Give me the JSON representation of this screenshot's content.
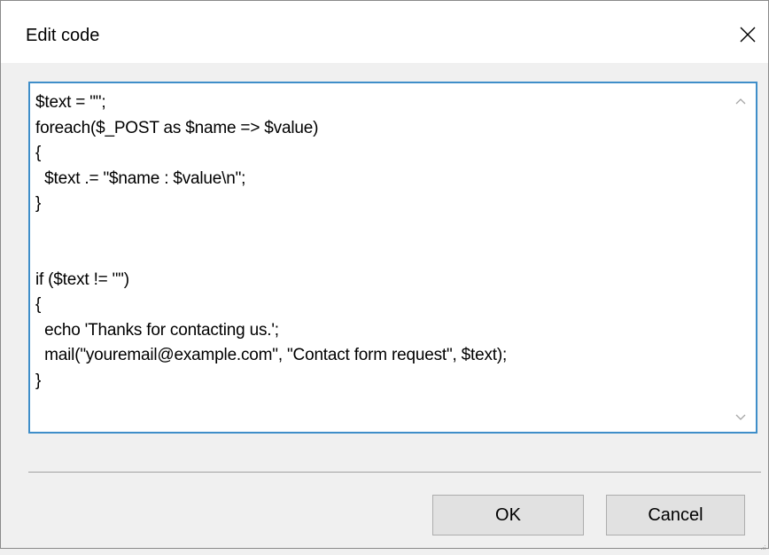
{
  "dialog": {
    "title": "Edit code",
    "close_icon": "close-icon"
  },
  "editor": {
    "code": "$text = \"\";\nforeach($_POST as $name => $value)\n{\n  $text .= \"$name : $value\\n\";\n}\n\n\nif ($text != \"\")\n{\n  echo 'Thanks for contacting us.';\n  mail(\"youremail@example.com\", \"Contact form request\", $text);\n}",
    "scroll_up_icon": "chevron-up-icon",
    "scroll_down_icon": "chevron-down-icon"
  },
  "buttons": {
    "ok_label": "OK",
    "cancel_label": "Cancel"
  },
  "colors": {
    "accent_border": "#3f8ec9",
    "dialog_background": "#f0f0f0",
    "button_background": "#e1e1e1"
  }
}
